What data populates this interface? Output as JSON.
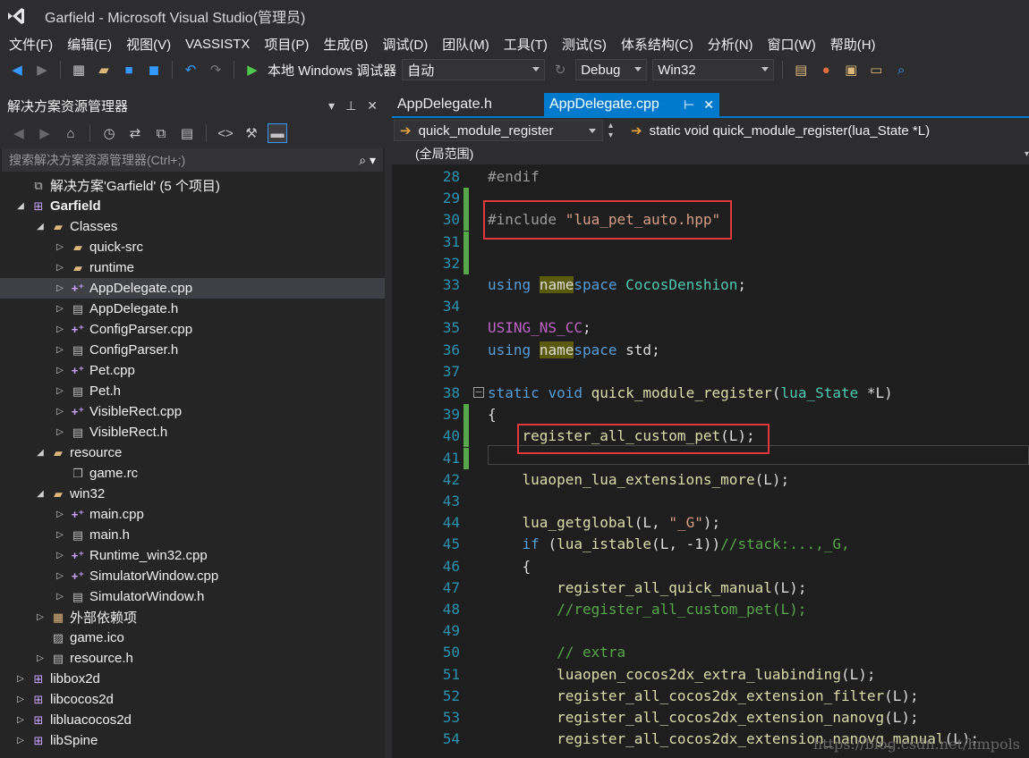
{
  "window": {
    "title": "Garfield - Microsoft Visual Studio(管理员)"
  },
  "menu": [
    "文件(F)",
    "编辑(E)",
    "视图(V)",
    "VASSISTX",
    "项目(P)",
    "生成(B)",
    "调试(D)",
    "团队(M)",
    "工具(T)",
    "测试(S)",
    "体系结构(C)",
    "分析(N)",
    "窗口(W)",
    "帮助(H)"
  ],
  "toolbar": {
    "debugger_label": "本地 Windows 调试器",
    "mode_combo": "自动",
    "config_combo": "Debug",
    "platform_combo": "Win32"
  },
  "solution_explorer": {
    "title": "解决方案资源管理器",
    "search_placeholder": "搜索解决方案资源管理器(Ctrl+;)",
    "items": [
      {
        "label": "解决方案'Garfield' (5 个项目)",
        "icon": "solution-icon",
        "expander": ""
      },
      {
        "label": "Garfield",
        "icon": "project-icon",
        "expander": "expanded"
      },
      {
        "label": "Classes",
        "icon": "folder-icon",
        "expander": "expanded"
      },
      {
        "label": "quick-src",
        "icon": "folder-icon",
        "expander": "collapsed"
      },
      {
        "label": "runtime",
        "icon": "folder-icon",
        "expander": "collapsed"
      },
      {
        "label": "AppDelegate.cpp",
        "icon": "cpp-file-icon",
        "expander": "collapsed"
      },
      {
        "label": "AppDelegate.h",
        "icon": "header-file-icon",
        "expander": "collapsed"
      },
      {
        "label": "ConfigParser.cpp",
        "icon": "cpp-file-icon",
        "expander": "collapsed"
      },
      {
        "label": "ConfigParser.h",
        "icon": "header-file-icon",
        "expander": "collapsed"
      },
      {
        "label": "Pet.cpp",
        "icon": "cpp-file-icon",
        "expander": "collapsed"
      },
      {
        "label": "Pet.h",
        "icon": "header-file-icon",
        "expander": "collapsed"
      },
      {
        "label": "VisibleRect.cpp",
        "icon": "cpp-file-icon",
        "expander": "collapsed"
      },
      {
        "label": "VisibleRect.h",
        "icon": "header-file-icon",
        "expander": "collapsed"
      },
      {
        "label": "resource",
        "icon": "folder-icon",
        "expander": "expanded"
      },
      {
        "label": "game.rc",
        "icon": "resource-file-icon",
        "expander": ""
      },
      {
        "label": "win32",
        "icon": "folder-icon",
        "expander": "expanded"
      },
      {
        "label": "main.cpp",
        "icon": "cpp-file-icon",
        "expander": "collapsed"
      },
      {
        "label": "main.h",
        "icon": "header-file-icon",
        "expander": "collapsed"
      },
      {
        "label": "Runtime_win32.cpp",
        "icon": "cpp-file-icon",
        "expander": "collapsed"
      },
      {
        "label": "SimulatorWindow.cpp",
        "icon": "cpp-file-icon",
        "expander": "collapsed"
      },
      {
        "label": "SimulatorWindow.h",
        "icon": "header-file-icon",
        "expander": "collapsed"
      },
      {
        "label": "外部依赖项",
        "icon": "external-deps-icon",
        "expander": "collapsed"
      },
      {
        "label": "game.ico",
        "icon": "image-file-icon",
        "expander": ""
      },
      {
        "label": "resource.h",
        "icon": "header-file-icon",
        "expander": "collapsed"
      },
      {
        "label": "libbox2d",
        "icon": "project-icon",
        "expander": "collapsed"
      },
      {
        "label": "libcocos2d",
        "icon": "project-icon",
        "expander": "collapsed"
      },
      {
        "label": "libluacocos2d",
        "icon": "project-icon",
        "expander": "collapsed"
      },
      {
        "label": "libSpine",
        "icon": "project-icon",
        "expander": "collapsed"
      }
    ]
  },
  "editor": {
    "tabs": [
      {
        "label": "AppDelegate.h",
        "active": false
      },
      {
        "label": "AppDelegate.cpp",
        "active": true
      }
    ],
    "nav_function_combo": "quick_module_register",
    "nav_signature_combo": "static void quick_module_register(lua_State *L)",
    "scope_combo": "(全局范围)",
    "lines": [
      {
        "num": "28",
        "text": "#endif"
      },
      {
        "num": "29",
        "text": ""
      },
      {
        "num": "30",
        "text": "#include \"lua_pet_auto.hpp\""
      },
      {
        "num": "31",
        "text": ""
      },
      {
        "num": "32",
        "text": ""
      },
      {
        "num": "33",
        "text": "using namespace CocosDenshion;"
      },
      {
        "num": "34",
        "text": ""
      },
      {
        "num": "35",
        "text": "USING_NS_CC;"
      },
      {
        "num": "36",
        "text": "using namespace std;"
      },
      {
        "num": "37",
        "text": ""
      },
      {
        "num": "38",
        "text": "static void quick_module_register(lua_State *L)"
      },
      {
        "num": "39",
        "text": "{"
      },
      {
        "num": "40",
        "text": "    register_all_custom_pet(L);"
      },
      {
        "num": "41",
        "text": ""
      },
      {
        "num": "42",
        "text": "    luaopen_lua_extensions_more(L);"
      },
      {
        "num": "43",
        "text": ""
      },
      {
        "num": "44",
        "text": "    lua_getglobal(L, \"_G\");"
      },
      {
        "num": "45",
        "text": "    if (lua_istable(L, -1))//stack:...,_G,"
      },
      {
        "num": "46",
        "text": "    {"
      },
      {
        "num": "47",
        "text": "        register_all_quick_manual(L);"
      },
      {
        "num": "48",
        "text": "        //register_all_custom_pet(L);"
      },
      {
        "num": "49",
        "text": ""
      },
      {
        "num": "50",
        "text": "        // extra"
      },
      {
        "num": "51",
        "text": "        luaopen_cocos2dx_extra_luabinding(L);"
      },
      {
        "num": "52",
        "text": "        register_all_cocos2dx_extension_filter(L);"
      },
      {
        "num": "53",
        "text": "        register_all_cocos2dx_extension_nanovg(L);"
      },
      {
        "num": "54",
        "text": "        register_all_cocos2dx_extension_nanovg_manual(L);"
      }
    ]
  },
  "watermark": "https://blog.csdn.net/hmpols",
  "colors": {
    "accent": "#007acc",
    "highlight_box": "#e03a3a",
    "change_marker": "#57a64a"
  }
}
